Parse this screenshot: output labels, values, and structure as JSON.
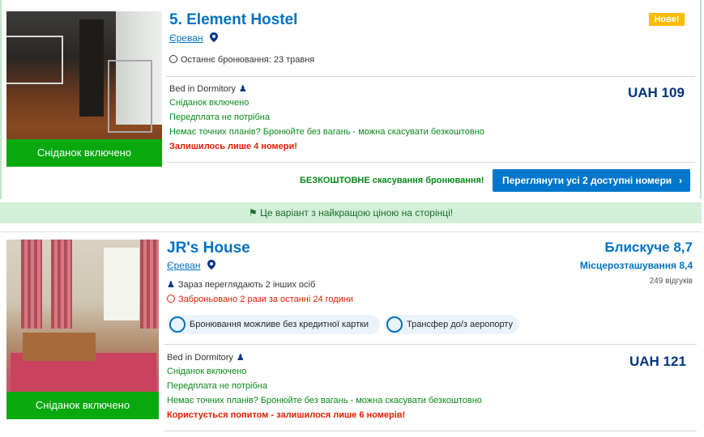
{
  "listing1": {
    "title": "5. Element Hostel",
    "city": "Єреван",
    "badge": "Нове!",
    "last_booking": "Останнє бронювання: 23 травня",
    "room_type": "Bed in Dormitory",
    "breakfast": "Сніданок включено",
    "no_prepay": "Передплата не потрібна",
    "flex": "Немає точних планів? Бронюйте без вагань - можна скасувати безкоштовно",
    "rooms_left": "Залишилось лише 4 номери!",
    "price": "UAH 109",
    "photo_ribbon": "Сніданок включено",
    "free_cancel": "БЕЗКОШТОВНЕ скасування бронювання!",
    "view_button": "Переглянути усі 2 доступні номери"
  },
  "best_price_bar": "Це варіант з найкращою ціною на сторінці!",
  "listing2": {
    "title": "JR's House",
    "city": "Єреван",
    "score_text": "Блискуче 8,7",
    "location_score": "Місцерозташування 8,4",
    "reviews": "249 відгуків",
    "viewing_now": "Зараз переглядають 2 інших осіб",
    "booked_recent": "Заброньовано 2 рази за останні 24 години",
    "feature_1": "Бронювання можливе без кредитної картки",
    "feature_2": "Трансфер до/з аеропорту",
    "room_type": "Bed in Dormitory",
    "breakfast": "Сніданок включено",
    "no_prepay": "Передплата не потрібна",
    "flex": "Немає точних планів? Бронюйте без вагань - можна скасувати безкоштовно",
    "rooms_left": "Користується попитом - залишилося лише 6 номерів!",
    "price": "UAH 121",
    "photo_ribbon": "Сніданок включено"
  },
  "icons": [
    "map-pin-icon",
    "clock-icon",
    "person-icon",
    "tag-icon",
    "chevron-right-icon",
    "credit-card-icon",
    "shuttle-icon"
  ],
  "colors": {
    "brand_blue": "#0071c2",
    "green": "#08a80f",
    "button_blue": "#0077cc",
    "badge_yellow": "#febb02",
    "red": "#e41c00"
  }
}
